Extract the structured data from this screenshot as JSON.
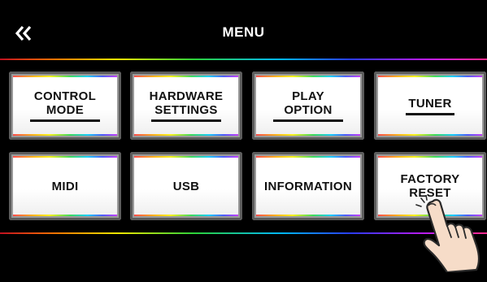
{
  "header": {
    "title": "MENU",
    "back_icon": "double-chevron-left-icon"
  },
  "menu": {
    "items": [
      {
        "id": "control-mode",
        "lines": [
          "CONTROL",
          "MODE"
        ],
        "has_submenu_underline": true
      },
      {
        "id": "hardware-settings",
        "lines": [
          "HARDWARE",
          "SETTINGS"
        ],
        "has_submenu_underline": true
      },
      {
        "id": "play-option",
        "lines": [
          "PLAY",
          "OPTION"
        ],
        "has_submenu_underline": true
      },
      {
        "id": "tuner",
        "lines": [
          "TUNER"
        ],
        "has_submenu_underline": true
      },
      {
        "id": "midi",
        "lines": [
          "MIDI"
        ],
        "has_submenu_underline": false
      },
      {
        "id": "usb",
        "lines": [
          "USB"
        ],
        "has_submenu_underline": false
      },
      {
        "id": "information",
        "lines": [
          "INFORMATION"
        ],
        "has_submenu_underline": false
      },
      {
        "id": "factory-reset",
        "lines": [
          "FACTORY",
          "RESET"
        ],
        "has_submenu_underline": false
      }
    ]
  },
  "overlay": {
    "pointer_icon": "tapping-hand-icon",
    "pointer_target": "factory-reset"
  },
  "colors": {
    "background": "#000000",
    "tile_face": "#ffffff",
    "tile_text": "#111111",
    "accent_rainbow": [
      "#c01020",
      "#ff7a00",
      "#f4e600",
      "#2bd23a",
      "#00b6ff",
      "#2a3cff",
      "#b21cff",
      "#ff2a8a"
    ]
  }
}
